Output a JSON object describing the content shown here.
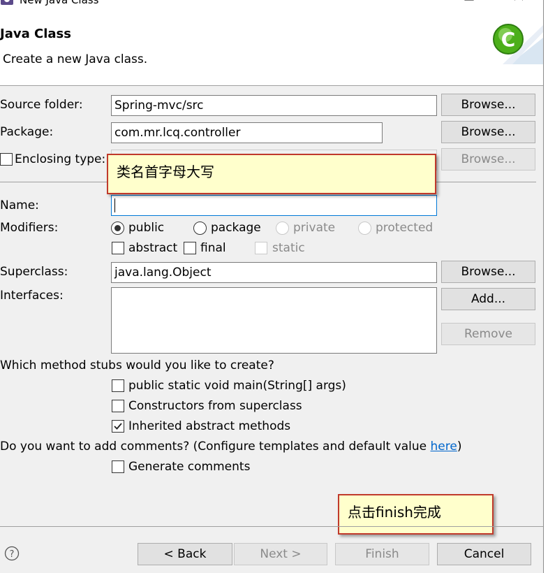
{
  "window": {
    "title": "New Java Class",
    "minimize_icon": "minimize-icon",
    "close_icon": "close-icon"
  },
  "header": {
    "title": "Java Class",
    "description": "Create a new Java class.",
    "logo_letter": "C"
  },
  "fields": {
    "source_folder": {
      "label": "Source folder:",
      "value": "Spring-mvc/src",
      "button": "Browse..."
    },
    "package": {
      "label": "Package:",
      "value": "com.mr.lcq.controller",
      "button": "Browse..."
    },
    "enclosing_type": {
      "label": "Enclosing type:",
      "value": "",
      "button": "Browse...",
      "checked": false
    },
    "name": {
      "label": "Name:",
      "value": ""
    },
    "modifiers": {
      "label": "Modifiers:",
      "access": [
        {
          "label": "public",
          "selected": true,
          "enabled": true
        },
        {
          "label": "package",
          "selected": false,
          "enabled": true
        },
        {
          "label": "private",
          "selected": false,
          "enabled": false
        },
        {
          "label": "protected",
          "selected": false,
          "enabled": false
        }
      ],
      "other": [
        {
          "label": "abstract",
          "checked": false,
          "enabled": true
        },
        {
          "label": "final",
          "checked": false,
          "enabled": true
        },
        {
          "label": "static",
          "checked": false,
          "enabled": false
        }
      ]
    },
    "superclass": {
      "label": "Superclass:",
      "value": "java.lang.Object",
      "button": "Browse..."
    },
    "interfaces": {
      "label": "Interfaces:",
      "add_button": "Add...",
      "remove_button": "Remove"
    }
  },
  "stubs": {
    "question": "Which method stubs would you like to create?",
    "options": [
      {
        "label": "public static void main(String[] args)",
        "checked": false
      },
      {
        "label": "Constructors from superclass",
        "checked": false
      },
      {
        "label": "Inherited abstract methods",
        "checked": true
      }
    ]
  },
  "comments": {
    "question_prefix": "Do you want to add comments? (Configure templates and default value ",
    "link": "here",
    "question_suffix": ")",
    "option": {
      "label": "Generate comments",
      "checked": false
    }
  },
  "annotations": {
    "name_hint": "类名首字母大写",
    "finish_hint": "点击finish完成"
  },
  "footer": {
    "help_icon": "help-icon",
    "back": "< Back",
    "next": "Next >",
    "finish": "Finish",
    "cancel": "Cancel"
  },
  "colors": {
    "accent": "#0078d7",
    "callout_bg": "#ffffcc",
    "callout_border": "#c0392b",
    "logo_green": "#4caf1a"
  }
}
